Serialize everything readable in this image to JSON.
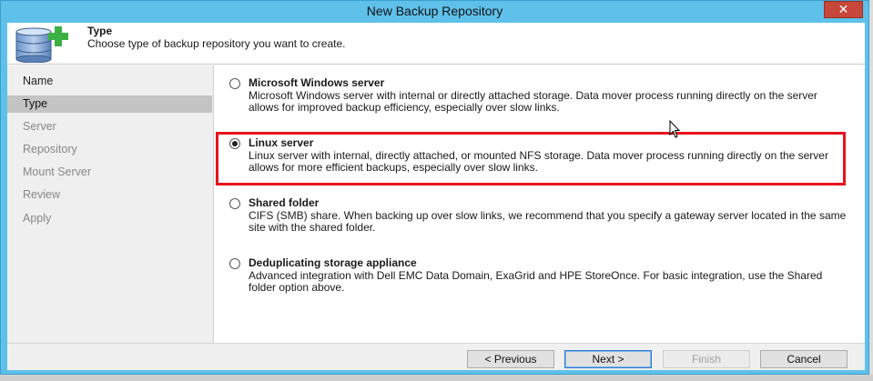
{
  "window": {
    "title": "New Backup Repository",
    "close_glyph": "✕"
  },
  "header": {
    "title": "Type",
    "subtitle": "Choose type of backup repository you want to create.",
    "icon": "database-add-icon"
  },
  "sidebar": {
    "steps": [
      {
        "label": "Name",
        "state": "done"
      },
      {
        "label": "Type",
        "state": "active"
      },
      {
        "label": "Server",
        "state": "future"
      },
      {
        "label": "Repository",
        "state": "future"
      },
      {
        "label": "Mount Server",
        "state": "future"
      },
      {
        "label": "Review",
        "state": "future"
      },
      {
        "label": "Apply",
        "state": "future"
      }
    ]
  },
  "options": [
    {
      "title": "Microsoft Windows server",
      "description": "Microsoft Windows server with internal or directly attached storage. Data mover process running directly on the server allows for improved backup efficiency, especially over slow links.",
      "selected": false
    },
    {
      "title": "Linux server",
      "description": "Linux server with internal, directly attached, or mounted NFS storage. Data mover process running directly on the server allows for more efficient backups, especially over slow links.",
      "selected": true
    },
    {
      "title": "Shared folder",
      "description": "CIFS (SMB) share. When backing up over slow links, we recommend that you specify a gateway server located in the same site with the shared folder.",
      "selected": false
    },
    {
      "title": "Deduplicating storage appliance",
      "description": "Advanced integration with Dell EMC Data Domain, ExaGrid and HPE StoreOnce. For basic integration, use the Shared folder option above.",
      "selected": false
    }
  ],
  "footer": {
    "previous_label": "< Previous",
    "next_label": "Next >",
    "finish_label": "Finish",
    "cancel_label": "Cancel"
  },
  "colors": {
    "title_bar": "#5fc1ea",
    "highlight_box": "#e8121c",
    "close_button": "#c7483b",
    "icon_green": "#3cb043"
  }
}
